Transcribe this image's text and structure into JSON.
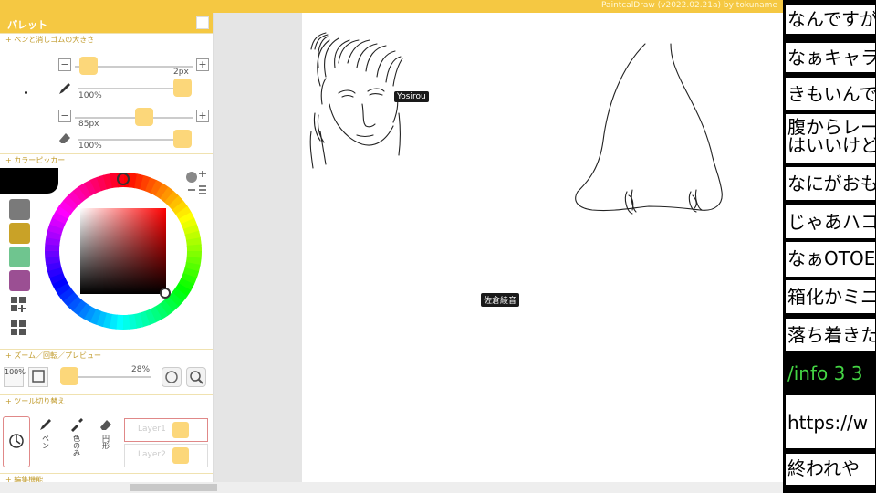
{
  "topbar": {
    "title": "PaintcalDraw (v2022.02.21a) by tokuname"
  },
  "palette": {
    "title": "パレット",
    "sections": {
      "pen_size": "+ ペンと消しゴムの大きさ",
      "color_picker": "+ カラーピッカー",
      "zoom": "+ ズーム／回転／プレビュー",
      "tools": "+ ツール切り替え",
      "edit": "+ 編集機能"
    },
    "pen": {
      "size": "2px",
      "opacity": "100%"
    },
    "eraser": {
      "size": "85px",
      "opacity": "100%"
    },
    "zoom": {
      "level_btn": "100%",
      "percent": "28%"
    },
    "tools": [
      {
        "name": "hand",
        "label": ""
      },
      {
        "name": "pen",
        "label": "ペン"
      },
      {
        "name": "eyedropper",
        "label": "色のみ"
      },
      {
        "name": "shape",
        "label": "円形"
      }
    ],
    "layers": [
      {
        "label": "Layer1"
      },
      {
        "label": "Layer2"
      }
    ],
    "swatches": [
      "#7a7a7a",
      "#c9a227",
      "#6fc58f",
      "#9b4f93"
    ],
    "current_color": "#000000"
  },
  "canvas": {
    "labels": [
      {
        "text": "Yosirou"
      },
      {
        "text": "佐倉綾音"
      }
    ]
  },
  "comments": [
    {
      "text": "なんですが"
    },
    {
      "text": "なぁキャラ("
    },
    {
      "text": "きもいんで"
    },
    {
      "text": "腹からレー"
    },
    {
      "text": "はいいけど"
    },
    {
      "text": "なにがおも"
    },
    {
      "text": "じゃあハコ"
    },
    {
      "text": "なぁOTOE"
    },
    {
      "text": "箱化かミニ"
    },
    {
      "text": "落ち着きた"
    },
    {
      "text": "/info 3 3"
    },
    {
      "text": "https://w"
    },
    {
      "text": "終われや"
    }
  ]
}
